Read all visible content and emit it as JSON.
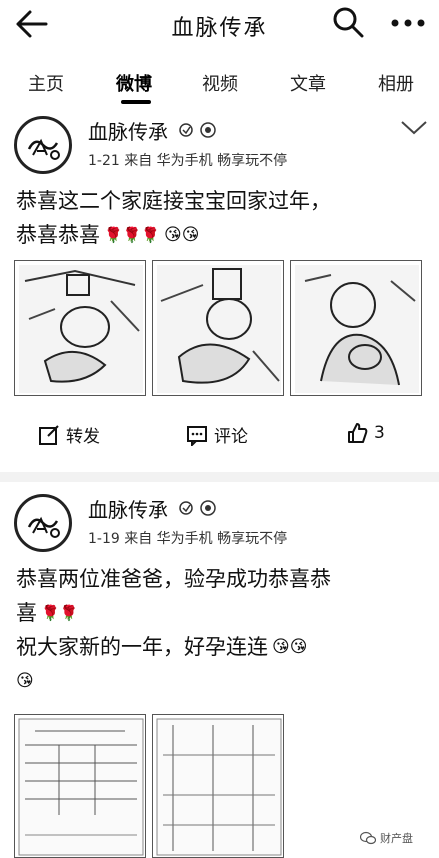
{
  "header": {
    "title": "血脉传承",
    "back_icon": "arrow-left-icon",
    "search_icon": "search-icon",
    "more_icon": "more-dots-icon"
  },
  "tabs": [
    {
      "label": "主页",
      "active": false
    },
    {
      "label": "微博",
      "active": true
    },
    {
      "label": "视频",
      "active": false
    },
    {
      "label": "文章",
      "active": false
    },
    {
      "label": "相册",
      "active": false
    }
  ],
  "posts": [
    {
      "username": "血脉传承",
      "meta": "1-21  来自 华为手机 畅享玩不停",
      "content_line1": "恭喜这二个家庭接宝宝回家过年，",
      "content_line2": "恭喜恭喜",
      "actions": {
        "repost": "转发",
        "comment": "评论",
        "like_count": "3"
      }
    },
    {
      "username": "血脉传承",
      "meta": "1-19  来自 华为手机 畅享玩不停",
      "content_line1": "恭喜两位准爸爸，验孕成功恭喜恭",
      "content_line2": "喜",
      "content_line3": "祝大家新的一年，好孕连连"
    }
  ],
  "watermark": "财产盘"
}
